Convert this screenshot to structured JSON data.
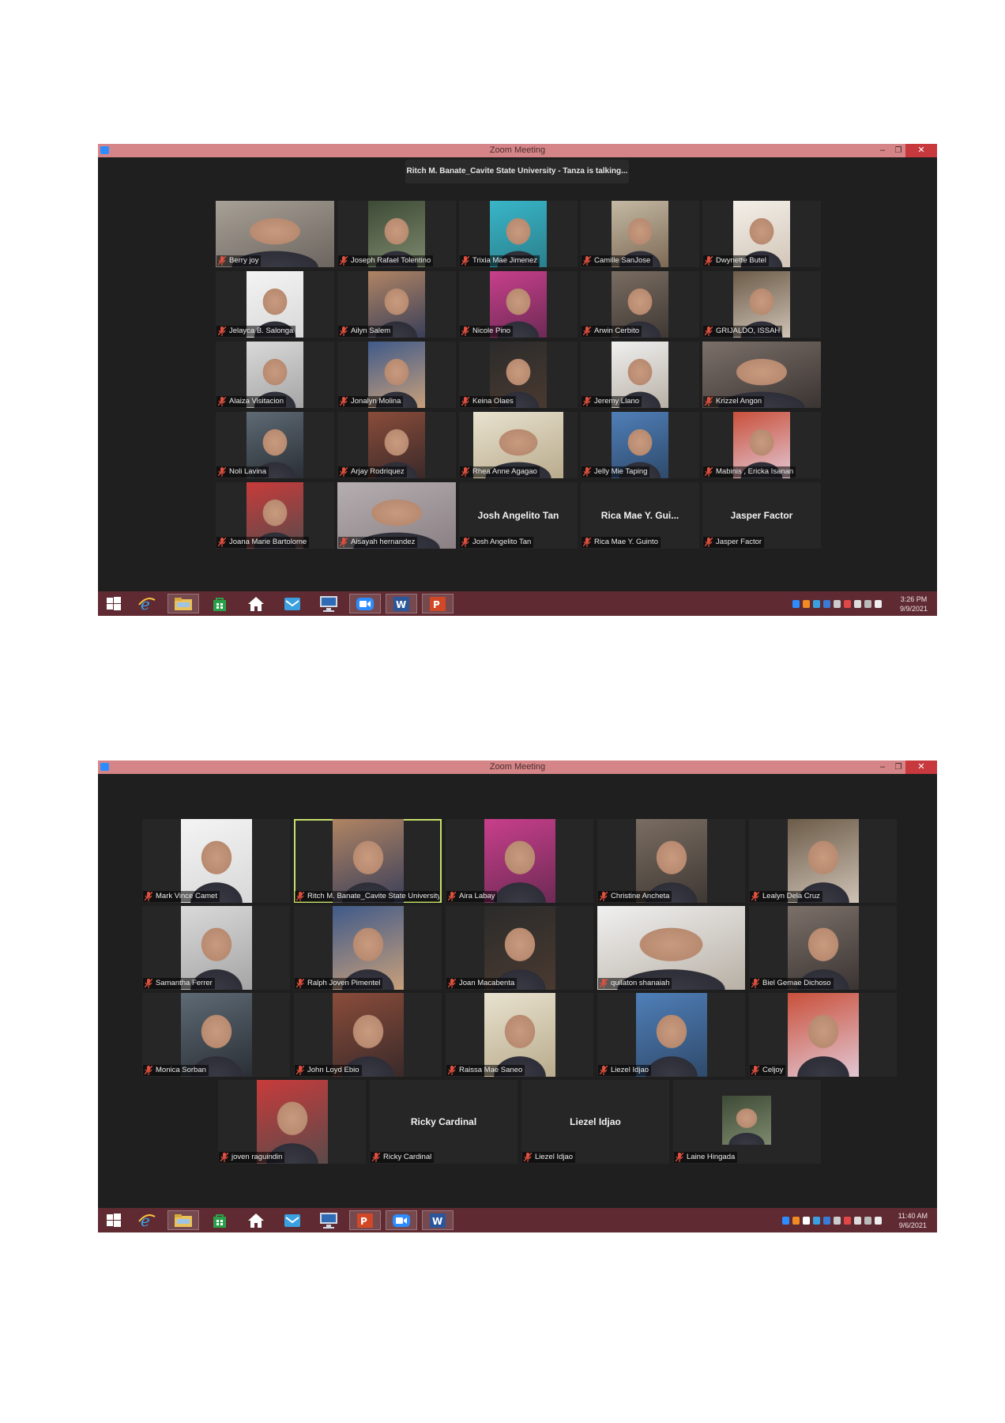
{
  "screenshot1": {
    "window_title": "Zoom Meeting",
    "talking_banner": "Ritch M. Banate_Cavite State University - Tanza is talking...",
    "participants": [
      {
        "name": "Berry joy"
      },
      {
        "name": "Joseph Rafael Tolentino"
      },
      {
        "name": "Trixia Mae Jimenez"
      },
      {
        "name": "Camille SanJose"
      },
      {
        "name": "Dwynette Butel"
      },
      {
        "name": "Jelayca B. Salonga"
      },
      {
        "name": "Ailyn Salem"
      },
      {
        "name": "Nicole Pino"
      },
      {
        "name": "Arwin Cerbito"
      },
      {
        "name": "GRIJALDO, ISSAH"
      },
      {
        "name": "Alaiza Visitacion"
      },
      {
        "name": "Jonalyn Molina"
      },
      {
        "name": "Keina Olaes"
      },
      {
        "name": "Jeremy Llano"
      },
      {
        "name": "Krizzel Angon"
      },
      {
        "name": "Noli Lavina"
      },
      {
        "name": "Arjay Rodriquez"
      },
      {
        "name": "Rhea Anne Agagao"
      },
      {
        "name": "Jelly Mie Taping"
      },
      {
        "name": "Mabinis , Ericka Isanan"
      },
      {
        "name": "Joana Marie Bartolome"
      },
      {
        "name": "Aisayah hernandez"
      },
      {
        "name": "Josh Angelito Tan",
        "display": "Josh Angelito Tan"
      },
      {
        "name": "Rica Mae Y. Guinto",
        "display": "Rica Mae Y. Gui..."
      },
      {
        "name": "Jasper Factor",
        "display": "Jasper Factor"
      }
    ],
    "clock": {
      "time": "3:26 PM",
      "date": "9/9/2021"
    }
  },
  "screenshot2": {
    "window_title": "Zoom Meeting",
    "participants": [
      {
        "name": "Mark Vince Camet"
      },
      {
        "name": "Ritch M. Banate_Cavite State University..."
      },
      {
        "name": "Aira Labay"
      },
      {
        "name": "Christine Ancheta"
      },
      {
        "name": "Lealyn Dela Cruz"
      },
      {
        "name": "Samantha Ferrer"
      },
      {
        "name": "Ralph Joven Pimentel"
      },
      {
        "name": "Joan Macabenta"
      },
      {
        "name": "quilaton shanaiah"
      },
      {
        "name": "Biel Gemae Dichoso"
      },
      {
        "name": "Monica Sorban"
      },
      {
        "name": "John Loyd Ebio"
      },
      {
        "name": "Raissa Mae Saneo"
      },
      {
        "name": "Liezel Idjao"
      },
      {
        "name": "Celjoy"
      },
      {
        "name": "joven raguindin"
      },
      {
        "name": "Ricky Cardinal",
        "display": "Ricky Cardinal"
      },
      {
        "name": "Liezel Idjao",
        "display": "Liezel Idjao"
      },
      {
        "name": "Laine Hingada"
      }
    ],
    "clock": {
      "time": "11:40 AM",
      "date": "9/6/2021"
    }
  },
  "icons": {
    "muted_mic": "mic-off-icon",
    "taskbar": [
      "windows-start-icon",
      "internet-explorer-icon",
      "file-explorer-icon",
      "store-icon",
      "home-icon",
      "mail-icon",
      "computer-icon",
      "zoom-icon",
      "word-icon",
      "powerpoint-icon"
    ]
  },
  "colors": {
    "titlebar": "#d58587",
    "close_button": "#c7393d",
    "window_bg": "#1f1f1f",
    "tile_bg": "#262626",
    "taskbar": "#5f2a31",
    "active_speaker_border": "#c6e06a",
    "muted_mic": "#e0503f"
  }
}
